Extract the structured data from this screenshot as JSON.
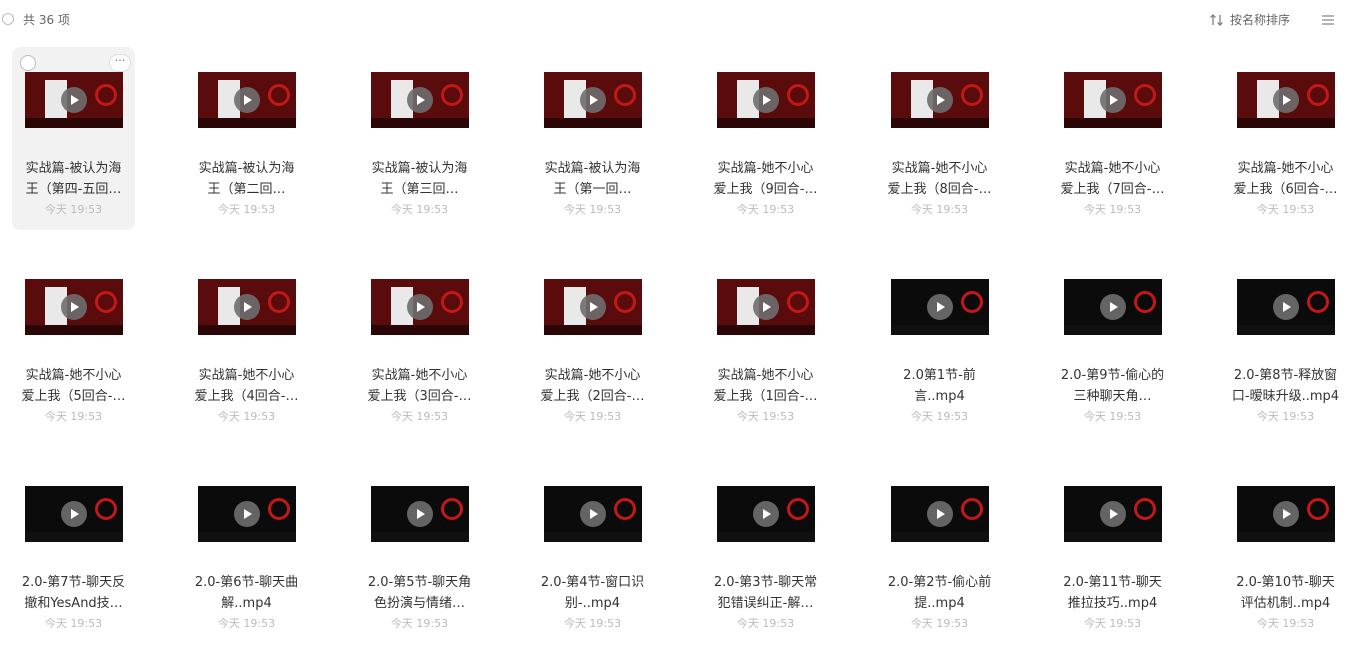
{
  "header": {
    "count": "共 36 项",
    "sort_label": "按名称排序",
    "icons": {
      "select_all": "circle-checkbox-icon",
      "sort": "sort-arrows-icon",
      "view": "list-view-icon"
    }
  },
  "items": [
    {
      "line1": "实战篇-被认为海",
      "line2": "王（第四-五回…",
      "time": "今天 19:53",
      "thumb": "red",
      "selected": true
    },
    {
      "line1": "实战篇-被认为海",
      "line2": "王（第二回…",
      "time": "今天 19:53",
      "thumb": "red"
    },
    {
      "line1": "实战篇-被认为海",
      "line2": "王（第三回…",
      "time": "今天 19:53",
      "thumb": "red"
    },
    {
      "line1": "实战篇-被认为海",
      "line2": "王（第一回…",
      "time": "今天 19:53",
      "thumb": "red"
    },
    {
      "line1": "实战篇-她不小心",
      "line2": "爱上我（9回合-…",
      "time": "今天 19:53",
      "thumb": "red"
    },
    {
      "line1": "实战篇-她不小心",
      "line2": "爱上我（8回合-…",
      "time": "今天 19:53",
      "thumb": "red"
    },
    {
      "line1": "实战篇-她不小心",
      "line2": "爱上我（7回合-…",
      "time": "今天 19:53",
      "thumb": "red"
    },
    {
      "line1": "实战篇-她不小心",
      "line2": "爱上我（6回合-…",
      "time": "今天 19:53",
      "thumb": "red"
    },
    {
      "line1": "实战篇-她不小心",
      "line2": "爱上我（5回合-…",
      "time": "今天 19:53",
      "thumb": "red"
    },
    {
      "line1": "实战篇-她不小心",
      "line2": "爱上我（4回合-…",
      "time": "今天 19:53",
      "thumb": "red"
    },
    {
      "line1": "实战篇-她不小心",
      "line2": "爱上我（3回合-…",
      "time": "今天 19:53",
      "thumb": "red"
    },
    {
      "line1": "实战篇-她不小心",
      "line2": "爱上我（2回合-…",
      "time": "今天 19:53",
      "thumb": "red"
    },
    {
      "line1": "实战篇-她不小心",
      "line2": "爱上我（1回合-…",
      "time": "今天 19:53",
      "thumb": "red"
    },
    {
      "line1": "2.0第1节-前",
      "line2": "言..mp4",
      "time": "今天 19:53",
      "thumb": "dark"
    },
    {
      "line1": "2.0-第9节-偷心的",
      "line2": "三种聊天角…",
      "time": "今天 19:53",
      "thumb": "dark"
    },
    {
      "line1": "2.0-第8节-释放窗",
      "line2": "口-暧昧升级..mp4",
      "time": "今天 19:53",
      "thumb": "dark"
    },
    {
      "line1": "2.0-第7节-聊天反",
      "line2": "撤和YesAnd技…",
      "time": "今天 19:53",
      "thumb": "dark"
    },
    {
      "line1": "2.0-第6节-聊天曲",
      "line2": "解..mp4",
      "time": "今天 19:53",
      "thumb": "dark"
    },
    {
      "line1": "2.0-第5节-聊天角",
      "line2": "色扮演与情绪…",
      "time": "今天 19:53",
      "thumb": "dark"
    },
    {
      "line1": "2.0-第4节-窗口识",
      "line2": "别-..mp4",
      "time": "今天 19:53",
      "thumb": "dark"
    },
    {
      "line1": "2.0-第3节-聊天常",
      "line2": "犯错误纠正-解…",
      "time": "今天 19:53",
      "thumb": "dark"
    },
    {
      "line1": "2.0-第2节-偷心前",
      "line2": "提..mp4",
      "time": "今天 19:53",
      "thumb": "dark"
    },
    {
      "line1": "2.0-第11节-聊天",
      "line2": "推拉技巧..mp4",
      "time": "今天 19:53",
      "thumb": "dark"
    },
    {
      "line1": "2.0-第10节-聊天",
      "line2": "评估机制..mp4",
      "time": "今天 19:53",
      "thumb": "dark"
    }
  ],
  "more_label": "···"
}
